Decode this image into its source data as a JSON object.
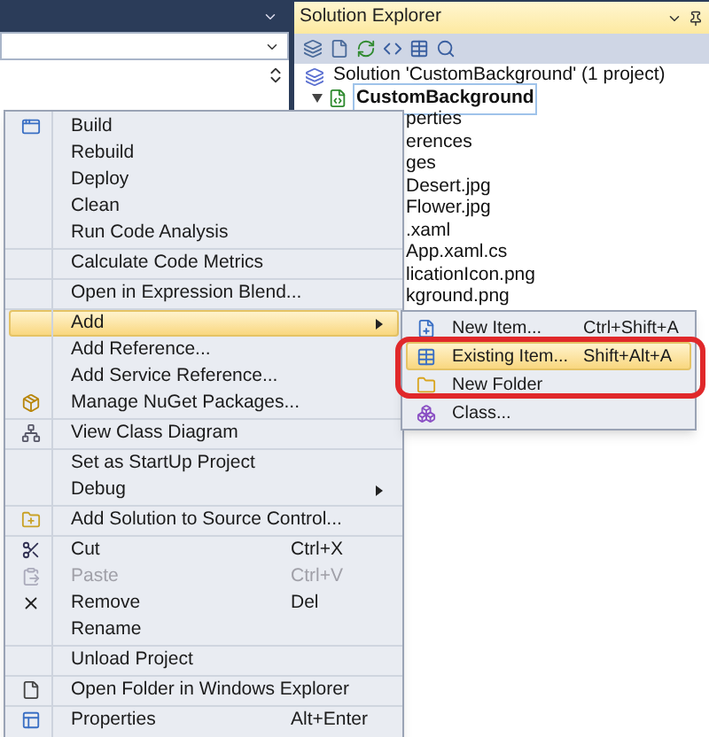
{
  "solution_explorer": {
    "title": "Solution Explorer",
    "tree": [
      {
        "label": "Solution 'CustomBackground' (1 project)",
        "bold": false,
        "children": [
          {
            "label": "CustomBackground",
            "bold": true,
            "expanded": true,
            "children": [
              {
                "label": "perties"
              },
              {
                "label": "erences"
              },
              {
                "label": "ges"
              },
              {
                "label": "Desert.jpg"
              },
              {
                "label": "Flower.jpg"
              },
              {
                "label": ".xaml"
              },
              {
                "label": "App.xaml.cs"
              },
              {
                "label": "licationIcon.png"
              },
              {
                "label": "kground.png"
              }
            ]
          }
        ]
      }
    ]
  },
  "context_menu": {
    "groups": [
      [
        {
          "label": "Build",
          "disabled": false,
          "highlighted": false,
          "has_submenu": false
        },
        {
          "label": "Rebuild",
          "disabled": false,
          "highlighted": false,
          "has_submenu": false
        },
        {
          "label": "Deploy",
          "disabled": false,
          "highlighted": false,
          "has_submenu": false
        },
        {
          "label": "Clean",
          "disabled": false,
          "highlighted": false,
          "has_submenu": false
        },
        {
          "label": "Run Code Analysis",
          "disabled": false,
          "highlighted": false,
          "has_submenu": false
        }
      ],
      [
        {
          "label": "Calculate Code Metrics",
          "disabled": false,
          "highlighted": false,
          "has_submenu": false
        }
      ],
      [
        {
          "label": "Open in Expression Blend...",
          "disabled": false,
          "highlighted": false,
          "has_submenu": false
        }
      ],
      [
        {
          "label": "Add",
          "disabled": false,
          "highlighted": true,
          "has_submenu": true
        },
        {
          "label": "Add Reference...",
          "disabled": false,
          "highlighted": false,
          "has_submenu": false
        },
        {
          "label": "Add Service Reference...",
          "disabled": false,
          "highlighted": false,
          "has_submenu": false
        },
        {
          "label": "Manage NuGet Packages...",
          "disabled": false,
          "highlighted": false,
          "has_submenu": false
        }
      ],
      [
        {
          "label": "View Class Diagram",
          "disabled": false,
          "highlighted": false,
          "has_submenu": false
        }
      ],
      [
        {
          "label": "Set as StartUp Project",
          "disabled": false,
          "highlighted": false,
          "has_submenu": false
        },
        {
          "label": "Debug",
          "disabled": false,
          "highlighted": false,
          "has_submenu": true
        }
      ],
      [
        {
          "label": "Add Solution to Source Control...",
          "disabled": false,
          "highlighted": false,
          "has_submenu": false
        }
      ],
      [
        {
          "label": "Cut",
          "shortcut": "Ctrl+X",
          "disabled": false,
          "highlighted": false,
          "has_submenu": false
        },
        {
          "label": "Paste",
          "shortcut": "Ctrl+V",
          "disabled": true,
          "highlighted": false,
          "has_submenu": false
        },
        {
          "label": "Remove",
          "shortcut": "Del",
          "disabled": false,
          "highlighted": false,
          "has_submenu": false
        },
        {
          "label": "Rename",
          "disabled": false,
          "highlighted": false,
          "has_submenu": false
        }
      ],
      [
        {
          "label": "Unload Project",
          "disabled": false,
          "highlighted": false,
          "has_submenu": false
        }
      ],
      [
        {
          "label": "Open Folder in Windows Explorer",
          "disabled": false,
          "highlighted": false,
          "has_submenu": false
        }
      ],
      [
        {
          "label": "Properties",
          "shortcut": "Alt+Enter",
          "disabled": false,
          "highlighted": false,
          "has_submenu": false
        }
      ]
    ]
  },
  "submenu": {
    "items": [
      {
        "label": "New Item...",
        "shortcut": "Ctrl+Shift+A",
        "highlighted": false
      },
      {
        "label": "Existing Item...",
        "shortcut": "Shift+Alt+A",
        "highlighted": true
      },
      {
        "label": "New Folder",
        "highlighted": false
      },
      {
        "label": "Class...",
        "highlighted": false
      }
    ]
  }
}
